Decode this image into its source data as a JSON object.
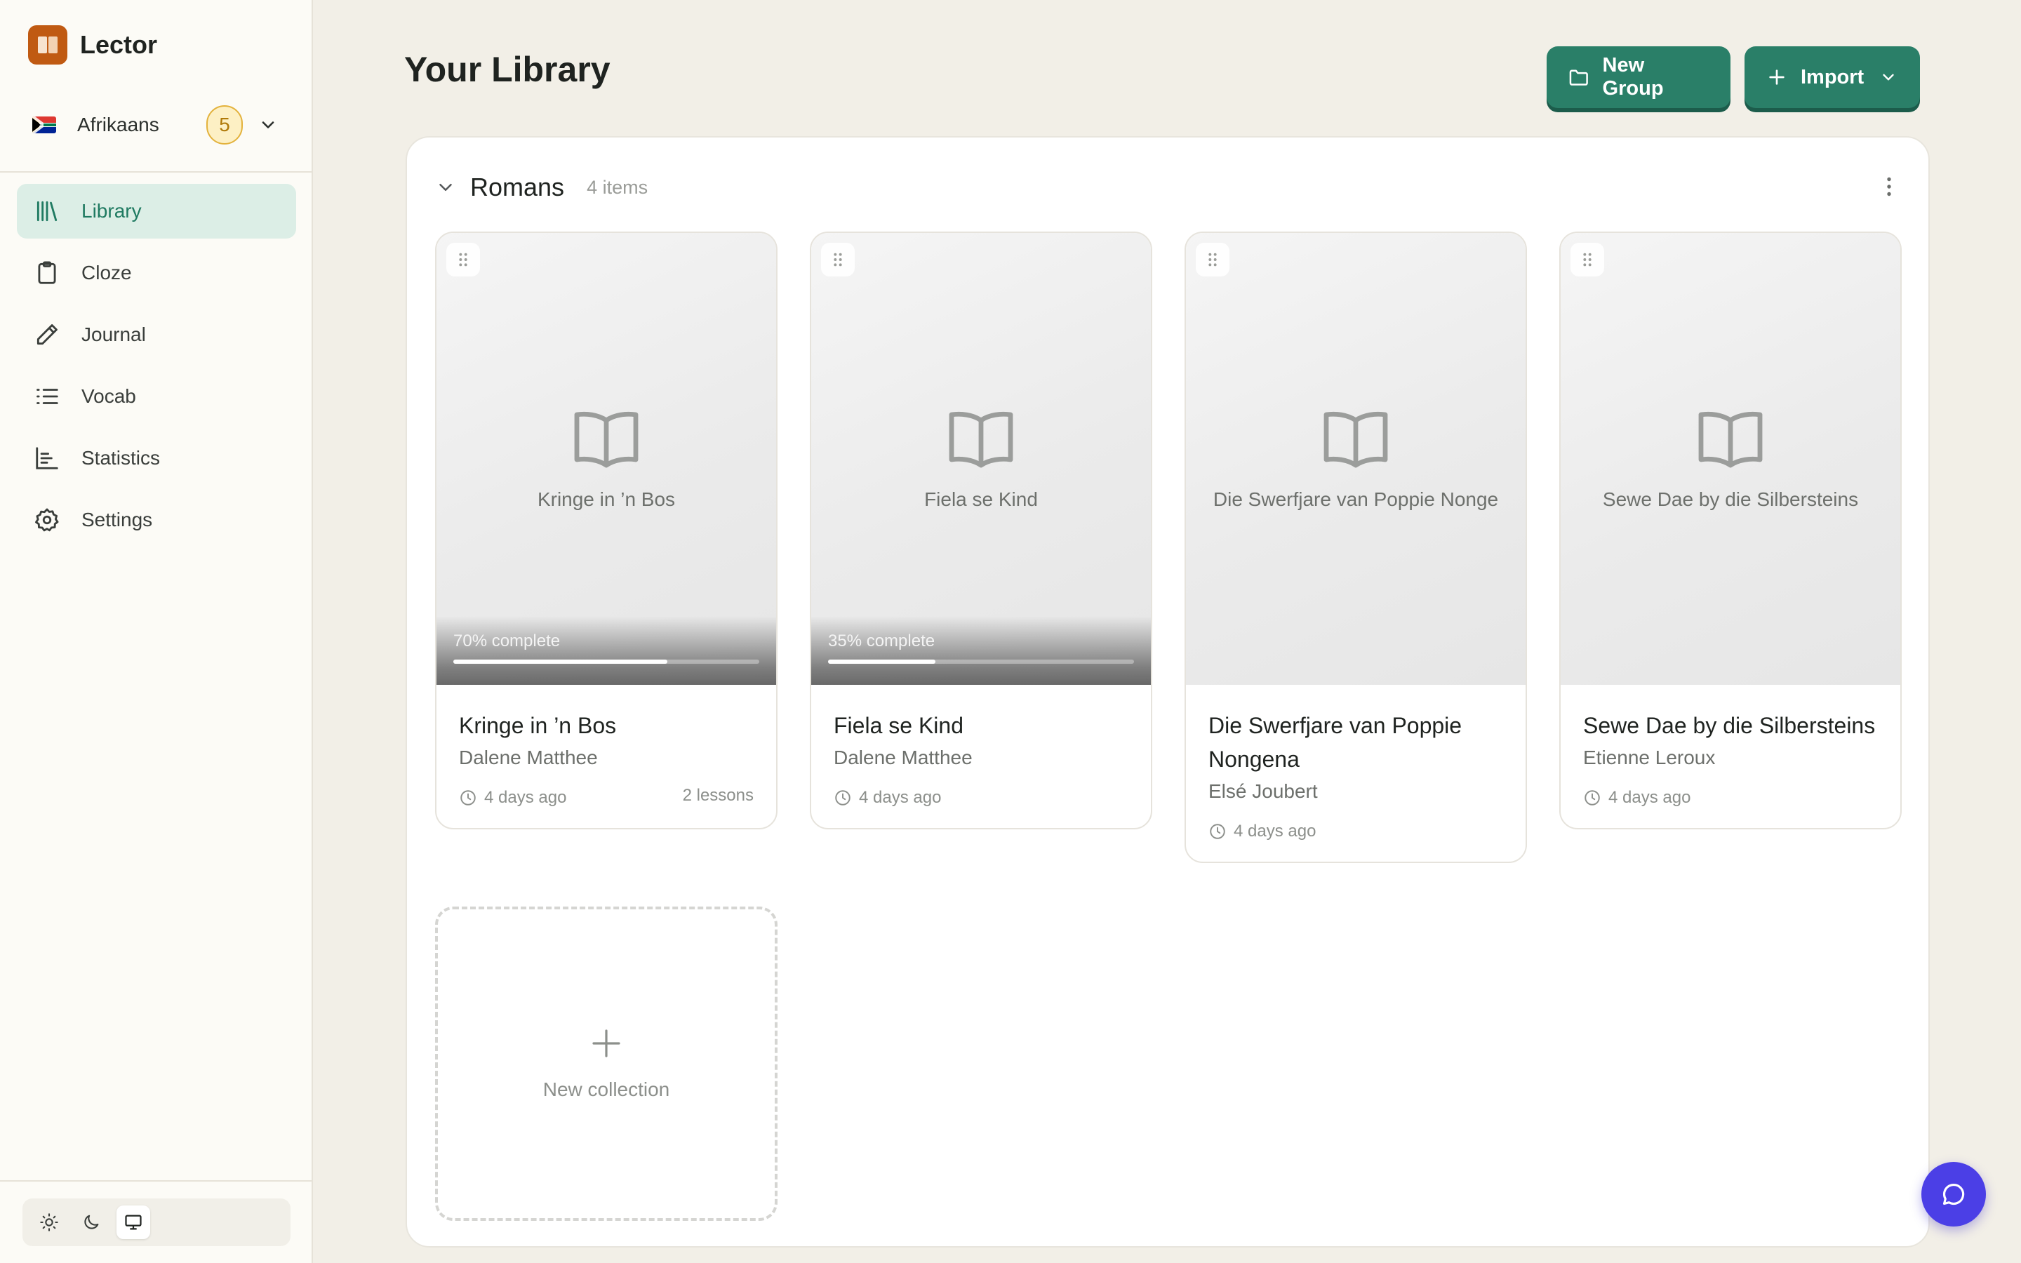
{
  "app": {
    "name": "Lector",
    "brand_color": "#c05a12",
    "accent": "#2a7f68"
  },
  "language": {
    "name": "Afrikaans",
    "badge": "5",
    "flag_icon": "south-africa-flag-icon"
  },
  "nav": {
    "items": [
      {
        "label": "Library",
        "icon": "library-icon",
        "active": true
      },
      {
        "label": "Cloze",
        "icon": "clipboard-icon",
        "active": false
      },
      {
        "label": "Journal",
        "icon": "pencil-icon",
        "active": false
      },
      {
        "label": "Vocab",
        "icon": "list-icon",
        "active": false
      },
      {
        "label": "Statistics",
        "icon": "bar-chart-icon",
        "active": false
      },
      {
        "label": "Settings",
        "icon": "gear-icon",
        "active": false
      }
    ]
  },
  "theme": {
    "options": [
      "light",
      "dark",
      "system"
    ],
    "selected": "system"
  },
  "header": {
    "title": "Your Library",
    "new_group_label": "New Group",
    "import_label": "Import"
  },
  "group": {
    "name": "Romans",
    "count": "4 items",
    "books": [
      {
        "cover_title": "Kringe in ’n Bos",
        "title": "Kringe in ’n Bos",
        "author": "Dalene Matthee",
        "updated": "4 days ago",
        "lessons": "2 lessons",
        "progress_label": "70% complete",
        "progress": 0.7
      },
      {
        "cover_title": "Fiela se Kind",
        "title": "Fiela se Kind",
        "author": "Dalene Matthee",
        "updated": "4 days ago",
        "lessons": "",
        "progress_label": "35% complete",
        "progress": 0.35
      },
      {
        "cover_title": "Die Swerfjare van Poppie Nonge",
        "title": "Die Swerfjare van Poppie Nongena",
        "author": "Elsé Joubert",
        "updated": "4 days ago",
        "lessons": "",
        "progress_label": "",
        "progress": null
      },
      {
        "cover_title": "Sewe Dae by die Silbersteins",
        "title": "Sewe Dae by die Silbersteins",
        "author": "Etienne Leroux",
        "updated": "4 days ago",
        "lessons": "",
        "progress_label": "",
        "progress": null
      }
    ],
    "new_collection_label": "New collection"
  },
  "chat": {
    "icon": "chat-bubble-icon",
    "color": "#4b3fe6"
  }
}
